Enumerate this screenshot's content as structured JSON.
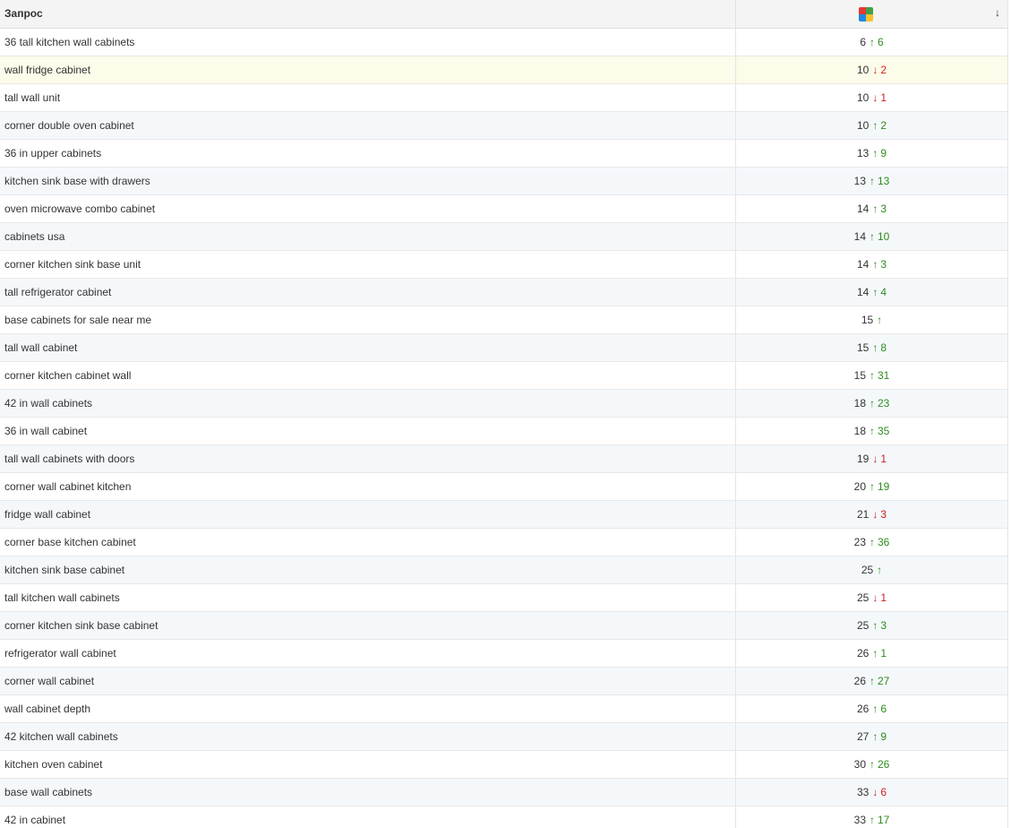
{
  "header": {
    "query_label": "Запрос",
    "engine_icon": "google-logo-icon",
    "sort_indicator": "↓",
    "icon_colors": [
      "#e53935",
      "#43a047",
      "#1e88e5",
      "#fbc02d"
    ]
  },
  "colors": {
    "up": "#2e8b1e",
    "down": "#cc1f1f",
    "highlight_row": "#fdfbe9",
    "alt_row": "#f5f8fb"
  },
  "rows": [
    {
      "query": "36 tall kitchen wall cabinets",
      "position": "6",
      "direction": "up",
      "delta": "6"
    },
    {
      "query": "wall fridge cabinet",
      "position": "10",
      "direction": "down",
      "delta": "2"
    },
    {
      "query": "tall wall unit",
      "position": "10",
      "direction": "down",
      "delta": "1"
    },
    {
      "query": "corner double oven cabinet",
      "position": "10",
      "direction": "up",
      "delta": "2"
    },
    {
      "query": "36 in upper cabinets",
      "position": "13",
      "direction": "up",
      "delta": "9"
    },
    {
      "query": "kitchen sink base with drawers",
      "position": "13",
      "direction": "up",
      "delta": "13"
    },
    {
      "query": "oven microwave combo cabinet",
      "position": "14",
      "direction": "up",
      "delta": "3"
    },
    {
      "query": "cabinets usa",
      "position": "14",
      "direction": "up",
      "delta": "10"
    },
    {
      "query": "corner kitchen sink base unit",
      "position": "14",
      "direction": "up",
      "delta": "3"
    },
    {
      "query": "tall refrigerator cabinet",
      "position": "14",
      "direction": "up",
      "delta": "4"
    },
    {
      "query": "base cabinets for sale near me",
      "position": "15",
      "direction": "up",
      "delta": ""
    },
    {
      "query": "tall wall cabinet",
      "position": "15",
      "direction": "up",
      "delta": "8"
    },
    {
      "query": "corner kitchen cabinet wall",
      "position": "15",
      "direction": "up",
      "delta": "31"
    },
    {
      "query": "42 in wall cabinets",
      "position": "18",
      "direction": "up",
      "delta": "23"
    },
    {
      "query": "36 in wall cabinet",
      "position": "18",
      "direction": "up",
      "delta": "35"
    },
    {
      "query": "tall wall cabinets with doors",
      "position": "19",
      "direction": "down",
      "delta": "1"
    },
    {
      "query": "corner wall cabinet kitchen",
      "position": "20",
      "direction": "up",
      "delta": "19"
    },
    {
      "query": "fridge wall cabinet",
      "position": "21",
      "direction": "down",
      "delta": "3"
    },
    {
      "query": "corner base kitchen cabinet",
      "position": "23",
      "direction": "up",
      "delta": "36"
    },
    {
      "query": "kitchen sink base cabinet",
      "position": "25",
      "direction": "up",
      "delta": ""
    },
    {
      "query": "tall kitchen wall cabinets",
      "position": "25",
      "direction": "down",
      "delta": "1"
    },
    {
      "query": "corner kitchen sink base cabinet",
      "position": "25",
      "direction": "up",
      "delta": "3"
    },
    {
      "query": "refrigerator wall cabinet",
      "position": "26",
      "direction": "up",
      "delta": "1"
    },
    {
      "query": "corner wall cabinet",
      "position": "26",
      "direction": "up",
      "delta": "27"
    },
    {
      "query": "wall cabinet depth",
      "position": "26",
      "direction": "up",
      "delta": "6"
    },
    {
      "query": "42 kitchen wall cabinets",
      "position": "27",
      "direction": "up",
      "delta": "9"
    },
    {
      "query": "kitchen oven cabinet",
      "position": "30",
      "direction": "up",
      "delta": "26"
    },
    {
      "query": "base wall cabinets",
      "position": "33",
      "direction": "down",
      "delta": "6"
    },
    {
      "query": "42 in cabinet",
      "position": "33",
      "direction": "up",
      "delta": "17"
    }
  ]
}
